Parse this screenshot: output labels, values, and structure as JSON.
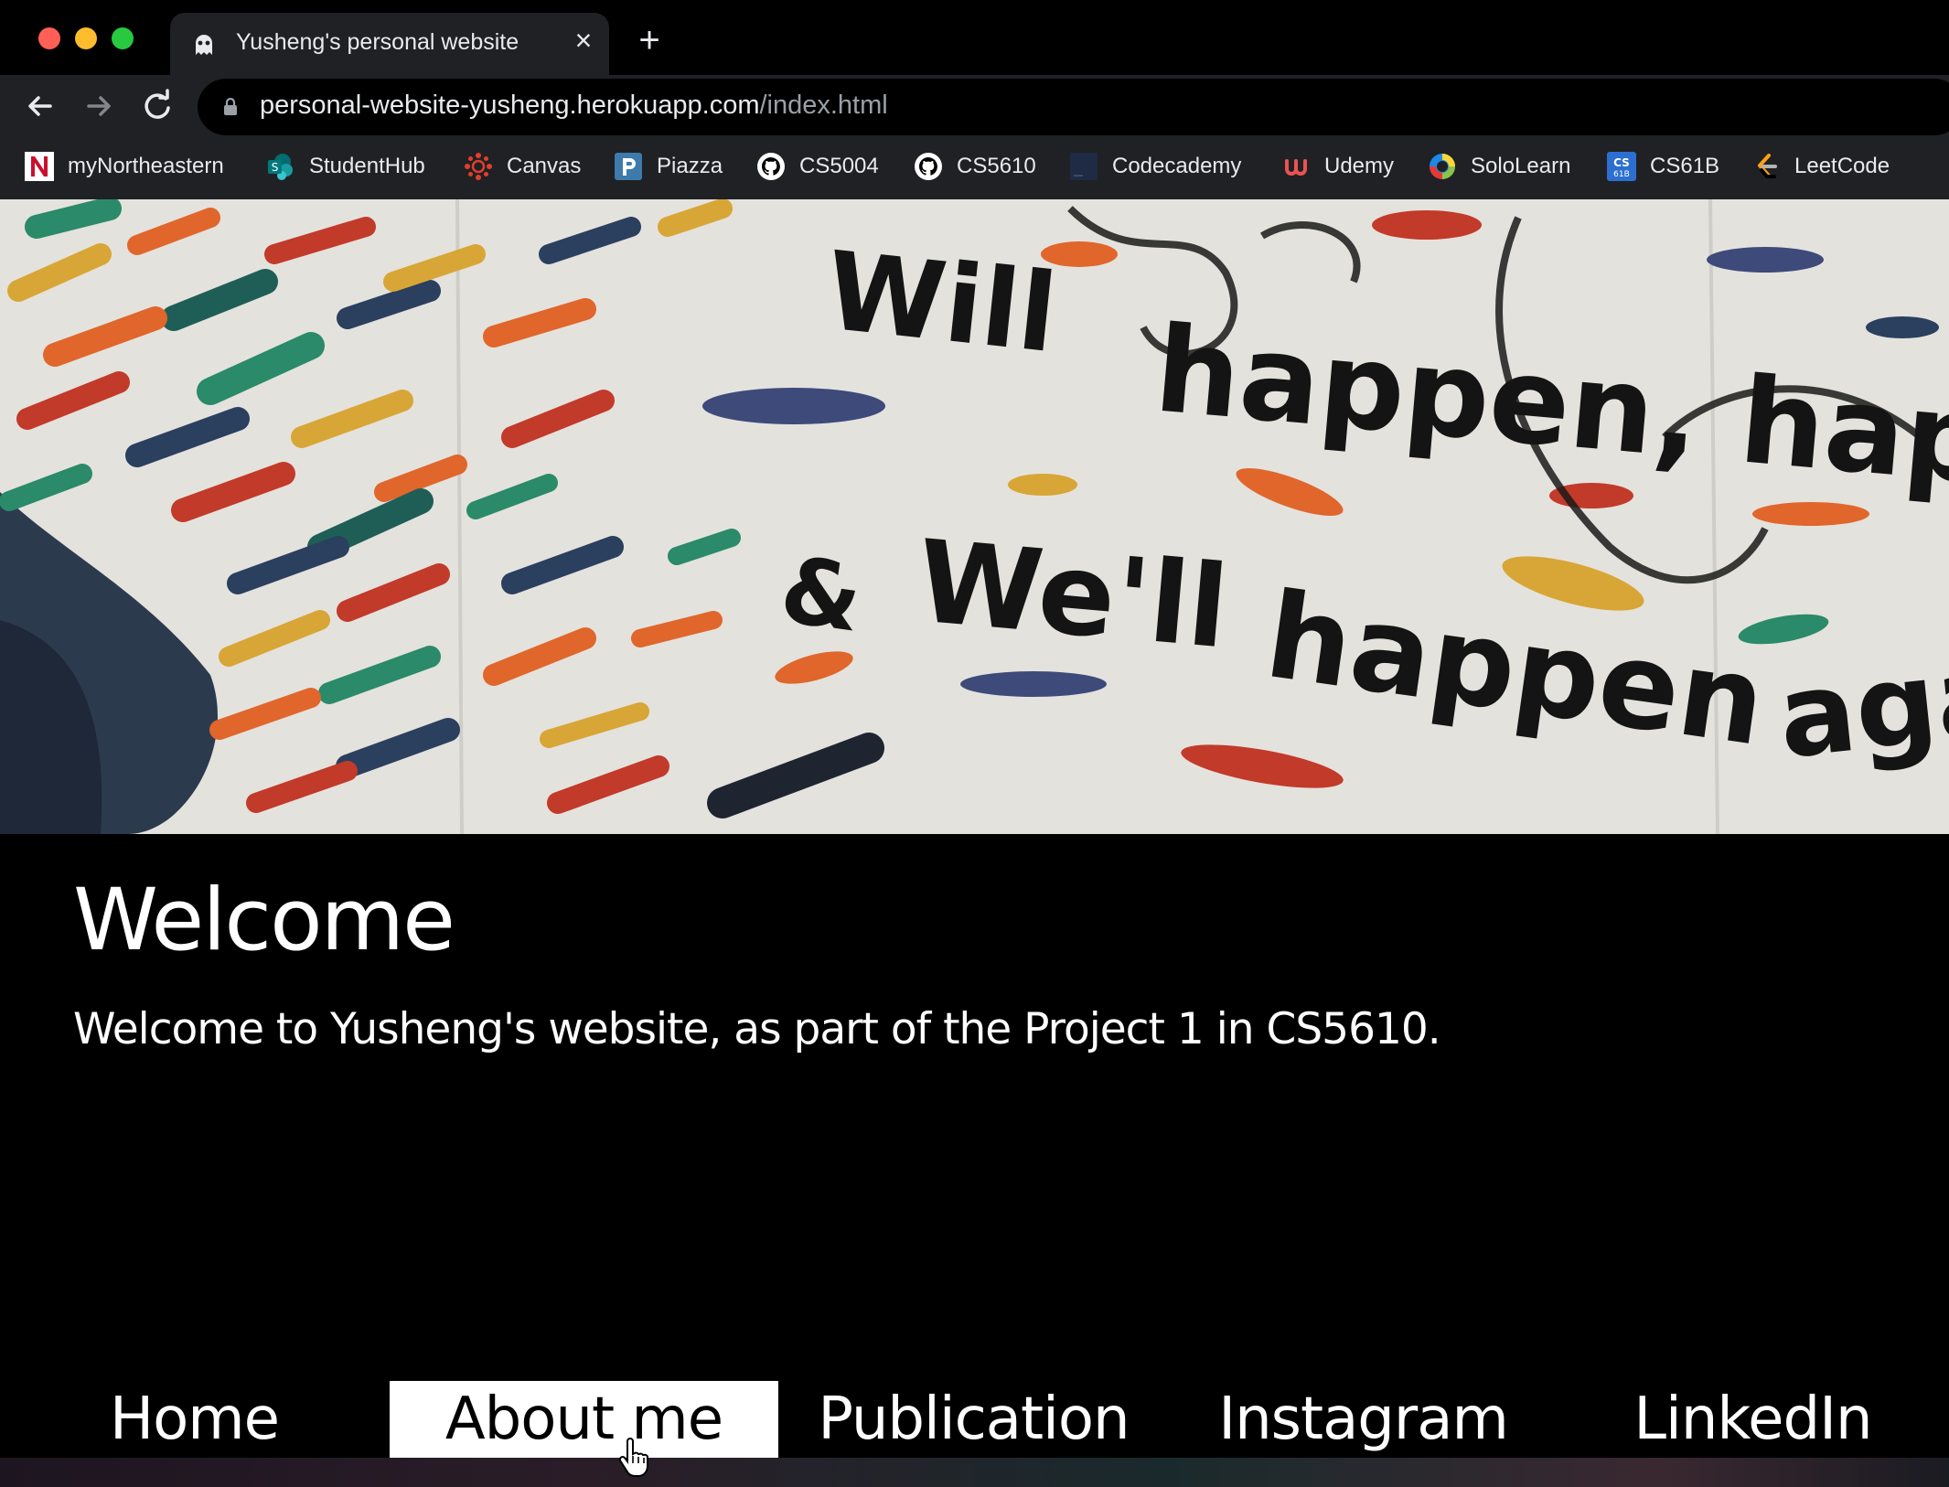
{
  "browser": {
    "tab_title": "Yusheng's personal website",
    "url_host": "personal-website-yusheng.herokuapp.com",
    "url_path": "/index.html",
    "bookmarks": [
      {
        "label": "myNortheastern",
        "icon": "northeastern-icon"
      },
      {
        "label": "StudentHub",
        "icon": "sharepoint-icon"
      },
      {
        "label": "Canvas",
        "icon": "canvas-icon"
      },
      {
        "label": "Piazza",
        "icon": "piazza-icon"
      },
      {
        "label": "CS5004",
        "icon": "github-icon"
      },
      {
        "label": "CS5610",
        "icon": "github-icon"
      },
      {
        "label": "Codecademy",
        "icon": "codecademy-icon"
      },
      {
        "label": "Udemy",
        "icon": "udemy-icon"
      },
      {
        "label": "SoloLearn",
        "icon": "sololearn-icon"
      },
      {
        "label": "CS61B",
        "icon": "cs61b-icon"
      },
      {
        "label": "LeetCode",
        "icon": "leetcode-icon"
      }
    ]
  },
  "hero": {
    "image_text": [
      "Will",
      "happen, hap",
      "&",
      "We'll",
      "happen",
      "aga"
    ]
  },
  "page": {
    "title": "Welcome",
    "description": "Welcome to Yusheng's website, as part of the Project 1 in CS5610."
  },
  "nav": {
    "items": [
      "Home",
      "About me",
      "Publication",
      "Instagram",
      "LinkedIn"
    ],
    "active": "About me"
  },
  "colors": {
    "page_background": "#000000",
    "active_nav_background": "#ffffff",
    "chrome_background": "#202124"
  }
}
